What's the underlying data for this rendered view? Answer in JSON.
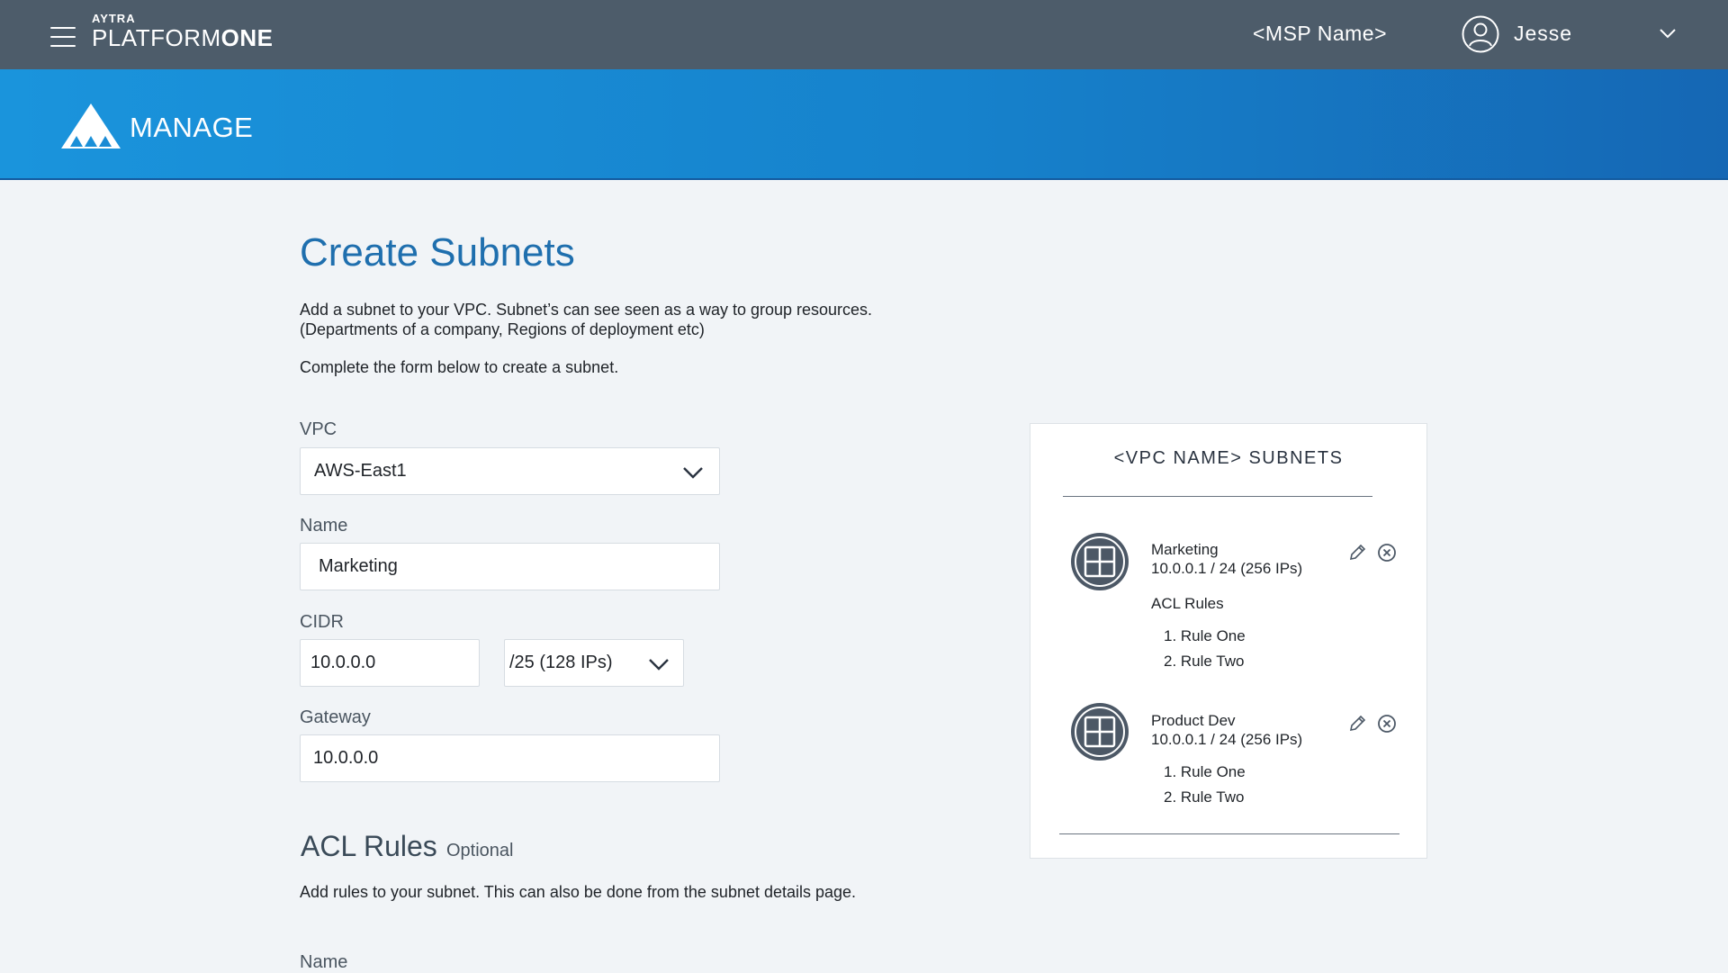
{
  "header": {
    "brand_small": "AYTRA",
    "brand_main": "PLATFORM",
    "brand_bold": "ONE",
    "msp_name": "<MSP Name>",
    "user_name": "Jesse",
    "bg_color": "#4d5c6a"
  },
  "banner": {
    "title": "MANAGE",
    "accent_color": "#1a94dc"
  },
  "page": {
    "title": "Create Subnets",
    "intro_line1": "Add a subnet to your VPC. Subnet’s can see seen as a way to group resources.",
    "intro_line2": "(Departments of a company, Regions of deployment etc)",
    "intro_line3": "Complete the form below to create a subnet."
  },
  "form": {
    "vpc_label": "VPC",
    "vpc_value": "AWS-East1",
    "name_label": "Name",
    "name_value": "Marketing",
    "cidr_label": "CIDR",
    "cidr_value": "10.0.0.0",
    "cidr_mask_value": "/25 (128 IPs)",
    "gateway_label": "Gateway",
    "gateway_value": "10.0.0.0"
  },
  "acl": {
    "title": "ACL Rules",
    "optional": "Optional",
    "description": "Add rules to your subnet. This can also be done from the subnet details page.",
    "name_label": "Name"
  },
  "panel": {
    "title": "<VPC NAME> SUBNETS",
    "subnets": [
      {
        "name": "Marketing",
        "cidr": "10.0.0.1 / 24  (256 IPs)",
        "acl_label": "ACL Rules",
        "rules": [
          "1. Rule One",
          "2. Rule Two"
        ]
      },
      {
        "name": "Product Dev",
        "cidr": "10.0.0.1 / 24  (256 IPs)",
        "rules": [
          "1. Rule One",
          "2. Rule Two"
        ]
      }
    ]
  },
  "icons": {
    "menu": "hamburger-menu-icon",
    "user": "user-avatar-icon",
    "dropdown": "chevron-down-icon",
    "logo": "triangle-logo-icon",
    "subnet": "grid-subnet-icon",
    "edit": "pencil-icon",
    "delete": "close-circle-icon"
  }
}
